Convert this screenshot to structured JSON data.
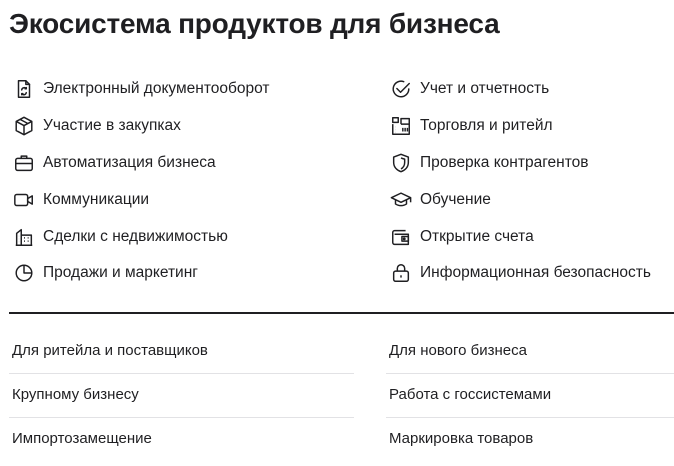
{
  "heading": "Экосистема продуктов для бизнеса",
  "products": {
    "left": [
      {
        "label": "Электронный документооборот",
        "icon": "document-sync-icon"
      },
      {
        "label": "Участие в закупках",
        "icon": "box-icon"
      },
      {
        "label": "Автоматизация бизнеса",
        "icon": "briefcase-icon"
      },
      {
        "label": "Коммуникации",
        "icon": "video-camera-icon"
      },
      {
        "label": "Сделки с недвижимостью",
        "icon": "building-icon"
      },
      {
        "label": "Продажи и маркетинг",
        "icon": "pie-chart-icon"
      }
    ],
    "right": [
      {
        "label": "Учет и отчетность",
        "icon": "check-circle-icon"
      },
      {
        "label": "Торговля и ритейл",
        "icon": "barcode-icon"
      },
      {
        "label": "Проверка контрагентов",
        "icon": "shield-icon"
      },
      {
        "label": "Обучение",
        "icon": "graduation-cap-icon"
      },
      {
        "label": "Открытие счета",
        "icon": "wallet-icon"
      },
      {
        "label": "Информационная безопасность",
        "icon": "lock-icon"
      }
    ]
  },
  "segments": {
    "left": [
      "Для ритейла и поставщиков",
      "Крупному бизнесу",
      "Импортозамещение"
    ],
    "right": [
      "Для нового бизнеса",
      "Работа с госсистемами",
      "Маркировка товаров"
    ]
  },
  "colors": {
    "text": "#1f1f22",
    "divider": "#1f1f22",
    "separator": "#e2e2e5",
    "background": "#ffffff"
  }
}
